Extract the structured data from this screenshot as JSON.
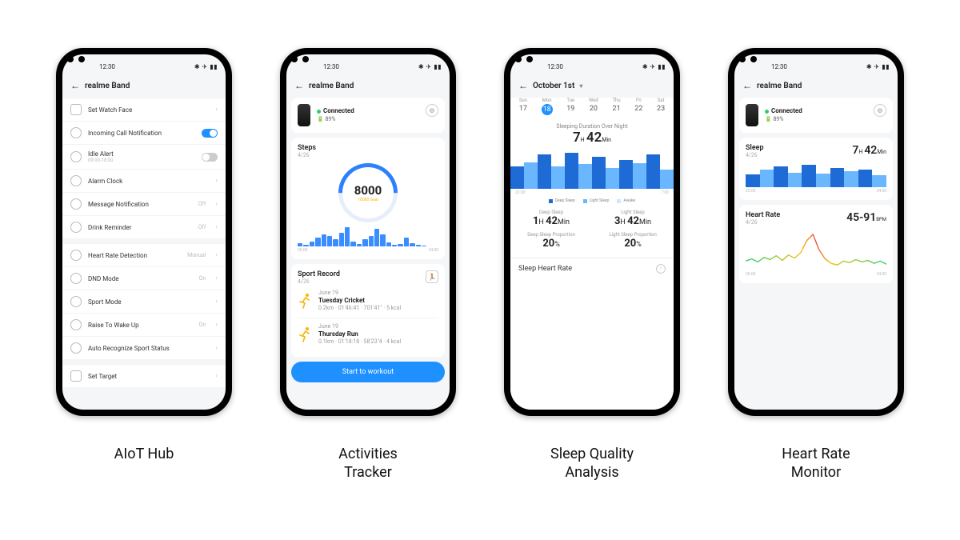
{
  "status": {
    "time": "12:30",
    "icons": "✱ ✈ ▮▮"
  },
  "captions": [
    "AIoT Hub",
    "Activities\nTracker",
    "Sleep Quality\nAnalysis",
    "Heart Rate\nMonitor"
  ],
  "p1": {
    "title": "realme Band",
    "items": [
      {
        "icon": "sq",
        "label": "Set Watch Face",
        "chev": true
      },
      {
        "icon": "rd",
        "label": "Incoming Call Notification",
        "toggle": "on"
      },
      {
        "icon": "rd",
        "label": "Idle Alert",
        "sub": "09:00-18:00",
        "toggle": "off"
      },
      {
        "icon": "rd",
        "label": "Alarm Clock",
        "chev": true
      },
      {
        "icon": "rd",
        "label": "Message Notification",
        "val": "Off",
        "chev": true
      },
      {
        "icon": "rd",
        "label": "Drink Reminder",
        "val": "Off",
        "chev": true
      }
    ],
    "items2": [
      {
        "icon": "rd",
        "label": "Heart Rate Detection",
        "val": "Manual",
        "chev": true
      },
      {
        "icon": "rd",
        "label": "DND Mode",
        "val": "On",
        "chev": true
      },
      {
        "icon": "rd",
        "label": "Sport Mode",
        "chev": true
      },
      {
        "icon": "rd",
        "label": "Raise To Wake Up",
        "val": "On",
        "chev": true
      },
      {
        "icon": "rd",
        "label": "Auto Recognize Sport Status",
        "chev": true
      }
    ],
    "items3": [
      {
        "icon": "sq",
        "label": "Set Target",
        "chev": true
      }
    ]
  },
  "p2": {
    "title": "realme Band",
    "device": {
      "status": "Connected",
      "battery": "89%"
    },
    "steps": {
      "title": "Steps",
      "date": "4/26",
      "value": "8000",
      "goal_label": "10000 Goal",
      "scale_l": "00:00",
      "scale_r": "24:00"
    },
    "sport": {
      "title": "Sport Record",
      "date": "4/26",
      "records": [
        {
          "date": "June 19",
          "name": "Tuesday Cricket",
          "meta": "0.2km · 01'46:41 · 701'41\" · 5 kcal"
        },
        {
          "date": "June 19",
          "name": "Thursday Run",
          "meta": "0.1km · 01'18:18 · 58'23\"4 · 4 kcal"
        }
      ]
    },
    "cta": "Start to workout"
  },
  "p3": {
    "title": "October 1st",
    "days": [
      [
        "Sun",
        "17"
      ],
      [
        "Mon",
        "18"
      ],
      [
        "Tue",
        "19"
      ],
      [
        "Wed",
        "20"
      ],
      [
        "Thu",
        "21"
      ],
      [
        "Fri",
        "22"
      ],
      [
        "Sat",
        "23"
      ]
    ],
    "selected": 1,
    "over_title": "Sleeping Duration Over Night",
    "hours": "7",
    "mins": "42",
    "scale_l": "23:00",
    "scale_r": "7:00",
    "legend": [
      [
        "#1f6bd6",
        "Deep Sleep"
      ],
      [
        "#6ab7ff",
        "Light Sleep"
      ],
      [
        "#cfe6ff",
        "Awake"
      ]
    ],
    "deep": {
      "label": "Deep Sleep",
      "h": "1",
      "m": "42",
      "prop_label": "Deep Sleep Proportion",
      "prop": "20"
    },
    "light": {
      "label": "Light Sleep",
      "h": "3",
      "m": "42",
      "prop_label": "Light Sleep Proportion",
      "prop": "20"
    },
    "shr": "Sleep Heart Rate"
  },
  "p4": {
    "title": "realme Band",
    "device": {
      "status": "Connected",
      "battery": "89%"
    },
    "sleep": {
      "title": "Sleep",
      "date": "4/26",
      "h": "7",
      "m": "42",
      "scale_l": "23:00",
      "scale_r": "24:00"
    },
    "hr": {
      "title": "Heart Rate",
      "date": "4/26",
      "range": "45-91",
      "unit": "BPM",
      "scale_l": "00:00",
      "scale_r": "24:00"
    }
  },
  "chart_data": [
    {
      "type": "bar",
      "title": "Steps histogram",
      "x": "hours 0-24",
      "values": [
        4,
        2,
        6,
        10,
        14,
        12,
        8,
        16,
        22,
        6,
        3,
        8,
        12,
        20,
        14,
        5,
        2,
        3,
        10,
        4,
        2,
        1,
        0,
        0
      ],
      "ylim": [
        0,
        24
      ],
      "note": "relative bar heights; absolute step count sums to ~8000"
    },
    {
      "type": "bar",
      "title": "Sleeping Duration Over Night",
      "x_range": [
        "23:00",
        "7:00"
      ],
      "series": [
        {
          "name": "Deep Sleep",
          "color": "#1f6bd6"
        },
        {
          "name": "Light Sleep",
          "color": "#6ab7ff"
        },
        {
          "name": "Awake",
          "color": "#cfe6ff"
        }
      ],
      "segments": [
        [
          "D",
          60
        ],
        [
          "L",
          70
        ],
        [
          "D",
          90
        ],
        [
          "L",
          60
        ],
        [
          "D",
          95
        ],
        [
          "L",
          65
        ],
        [
          "D",
          85
        ],
        [
          "L",
          55
        ],
        [
          "D",
          75
        ],
        [
          "L",
          68
        ],
        [
          "D",
          90
        ],
        [
          "L",
          50
        ]
      ],
      "total": "7h 42min",
      "deep_prop_pct": 20,
      "light_prop_pct": 20
    },
    {
      "type": "bar",
      "title": "Sleep card (phone 4)",
      "x_range": [
        "23:00",
        "24:00"
      ],
      "segments": [
        [
          "D",
          55
        ],
        [
          "L",
          72
        ],
        [
          "D",
          88
        ],
        [
          "L",
          60
        ],
        [
          "D",
          92
        ],
        [
          "L",
          58
        ],
        [
          "D",
          80
        ],
        [
          "L",
          66
        ],
        [
          "D",
          74
        ],
        [
          "L",
          50
        ]
      ],
      "total": "7h 42min"
    },
    {
      "type": "line",
      "title": "Heart Rate",
      "x_range": [
        "00:00",
        "24:00"
      ],
      "ylim": [
        45,
        91
      ],
      "unit": "BPM",
      "values": [
        55,
        58,
        54,
        60,
        57,
        62,
        56,
        63,
        59,
        66,
        82,
        90,
        70,
        58,
        52,
        50,
        55,
        53,
        57,
        54,
        56,
        52,
        55,
        51
      ]
    }
  ]
}
